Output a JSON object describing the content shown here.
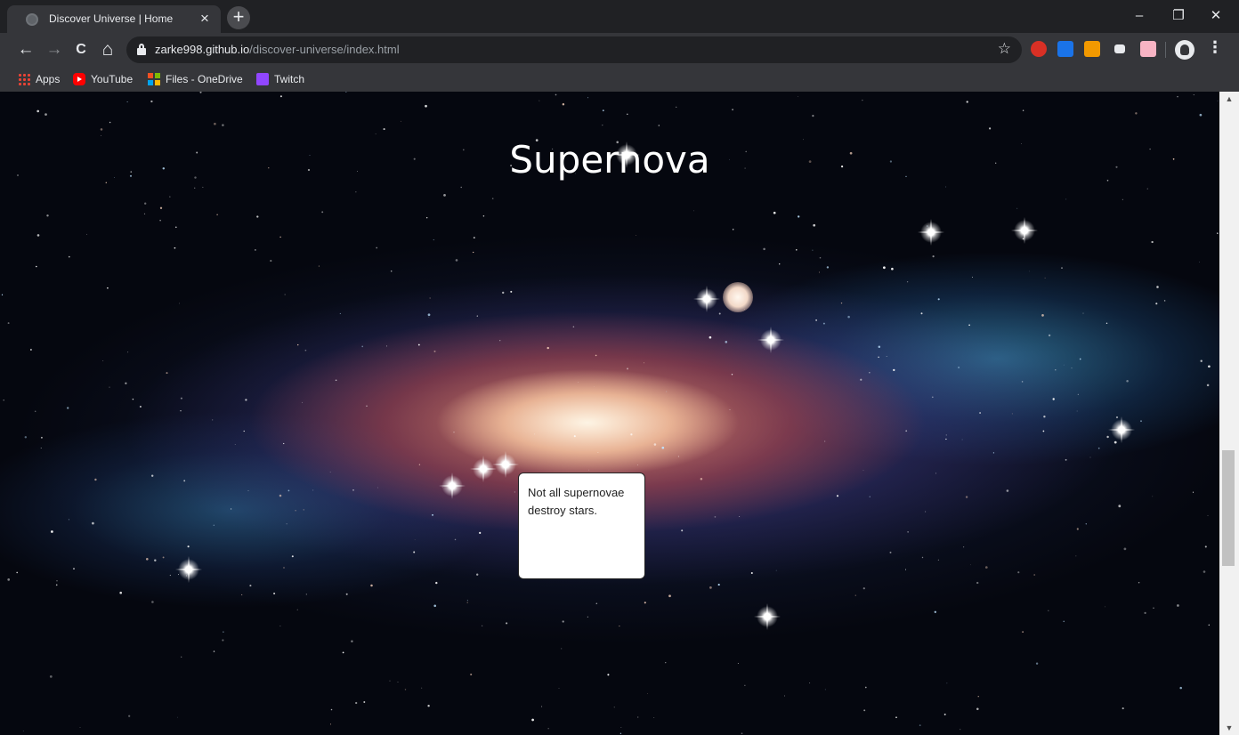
{
  "browser": {
    "tab_title": "Discover Universe | Home",
    "tab_close": "×",
    "new_tab": "+",
    "window_controls": {
      "minimize": "–",
      "restore": "❐",
      "close": "✕"
    },
    "nav": {
      "back": "←",
      "forward": "→",
      "reload": "C",
      "home": "⌂"
    },
    "url_host": "zarke998.github.io",
    "url_path": "/discover-universe/index.html",
    "star": "☆",
    "menu": "⋮",
    "extensions": [
      "red-extension-icon",
      "blue-extension-icon",
      "rss-extension-icon",
      "mail-extension-icon",
      "red-book-extension-icon"
    ]
  },
  "bookmarks": [
    {
      "label": "Apps",
      "icon": "apps-grid-icon"
    },
    {
      "label": "YouTube",
      "icon": "youtube-icon"
    },
    {
      "label": "Files - OneDrive",
      "icon": "microsoft-icon"
    },
    {
      "label": "Twitch",
      "icon": "twitch-icon"
    }
  ],
  "page": {
    "title": "Supernova",
    "tooltip_text": "Not all supernovae destroy stars.",
    "background": "galaxy-image"
  },
  "colors": {
    "chrome_dark": "#202124",
    "chrome_toolbar": "#35363a",
    "text_light": "#e8eaed"
  }
}
